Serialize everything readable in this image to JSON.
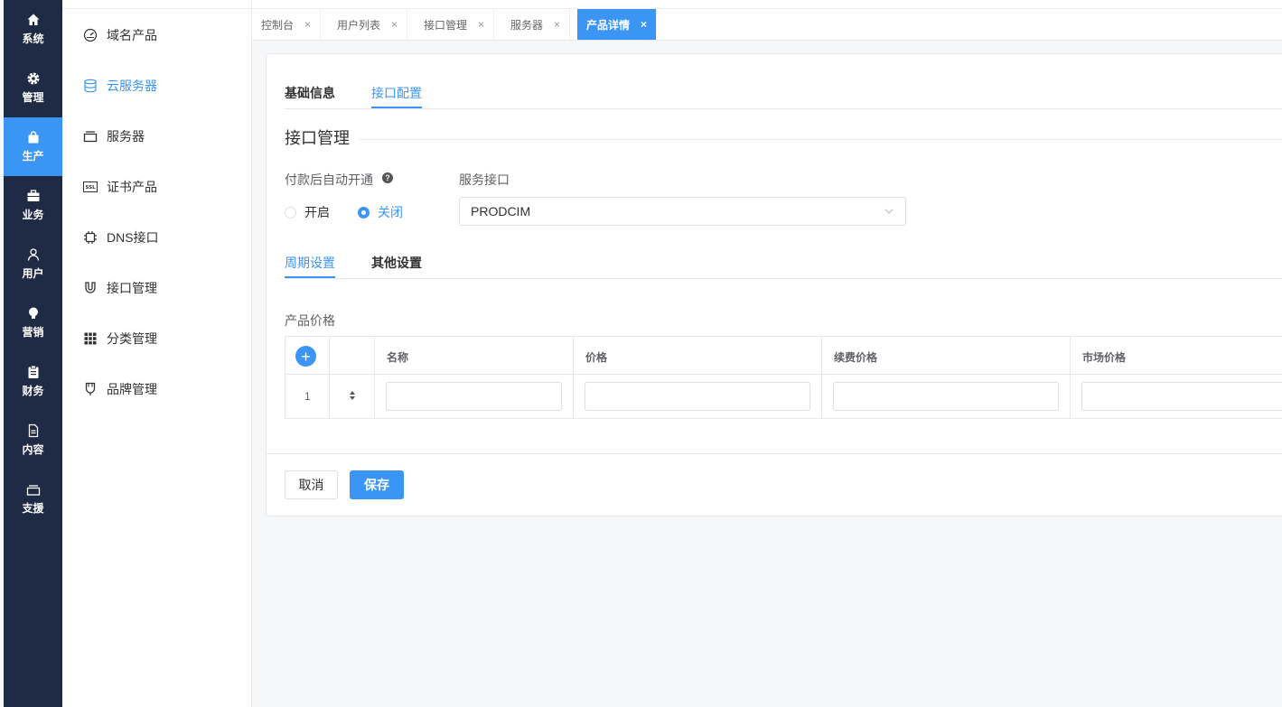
{
  "icon_bar": [
    {
      "label": "系统",
      "icon": "home-icon"
    },
    {
      "label": "管理",
      "icon": "gear-icon"
    },
    {
      "label": "生产",
      "icon": "bag-icon",
      "active": true
    },
    {
      "label": "业务",
      "icon": "briefcase-icon"
    },
    {
      "label": "用户",
      "icon": "user-icon"
    },
    {
      "label": "营销",
      "icon": "bulb-icon"
    },
    {
      "label": "财务",
      "icon": "clipboard-icon"
    },
    {
      "label": "内容",
      "icon": "document-icon"
    },
    {
      "label": "支援",
      "icon": "tray-icon"
    }
  ],
  "sidebar": {
    "items": [
      {
        "label": "域名产品",
        "icon": "gauge-icon"
      },
      {
        "label": "云服务器",
        "icon": "database-icon",
        "active": true
      },
      {
        "label": "服务器",
        "icon": "server-icon"
      },
      {
        "label": "证书产品",
        "icon": "ssl-icon",
        "badge": "SSL"
      },
      {
        "label": "DNS接口",
        "icon": "chip-icon"
      },
      {
        "label": "接口管理",
        "icon": "magnet-icon"
      },
      {
        "label": "分类管理",
        "icon": "grid-icon"
      },
      {
        "label": "品牌管理",
        "icon": "cup-icon"
      }
    ]
  },
  "tabs": [
    {
      "label": "控制台"
    },
    {
      "label": "用户列表"
    },
    {
      "label": "接口管理"
    },
    {
      "label": "服务器"
    },
    {
      "label": "产品详情",
      "active": true
    }
  ],
  "tab_close": "×",
  "card": {
    "top_tabs": [
      "基础信息",
      "接口配置"
    ],
    "section_title": "接口管理",
    "auto_open_label": "付款后自动开通",
    "help_glyph": "?",
    "radio_on_label": "开启",
    "radio_off_label": "关闭",
    "service_label": "服务接口",
    "service_value": "PRODCIM",
    "sub_tabs": [
      "周期设置",
      "其他设置"
    ],
    "price_label": "产品价格",
    "table": {
      "add_glyph": "+",
      "headers": [
        "名称",
        "价格",
        "续费价格",
        "市场价格"
      ],
      "rows": [
        {
          "index": "1"
        }
      ]
    },
    "cancel_label": "取消",
    "save_label": "保存"
  },
  "colors": {
    "accent": "#3a95f5",
    "nav_bg": "#1f2a44"
  }
}
